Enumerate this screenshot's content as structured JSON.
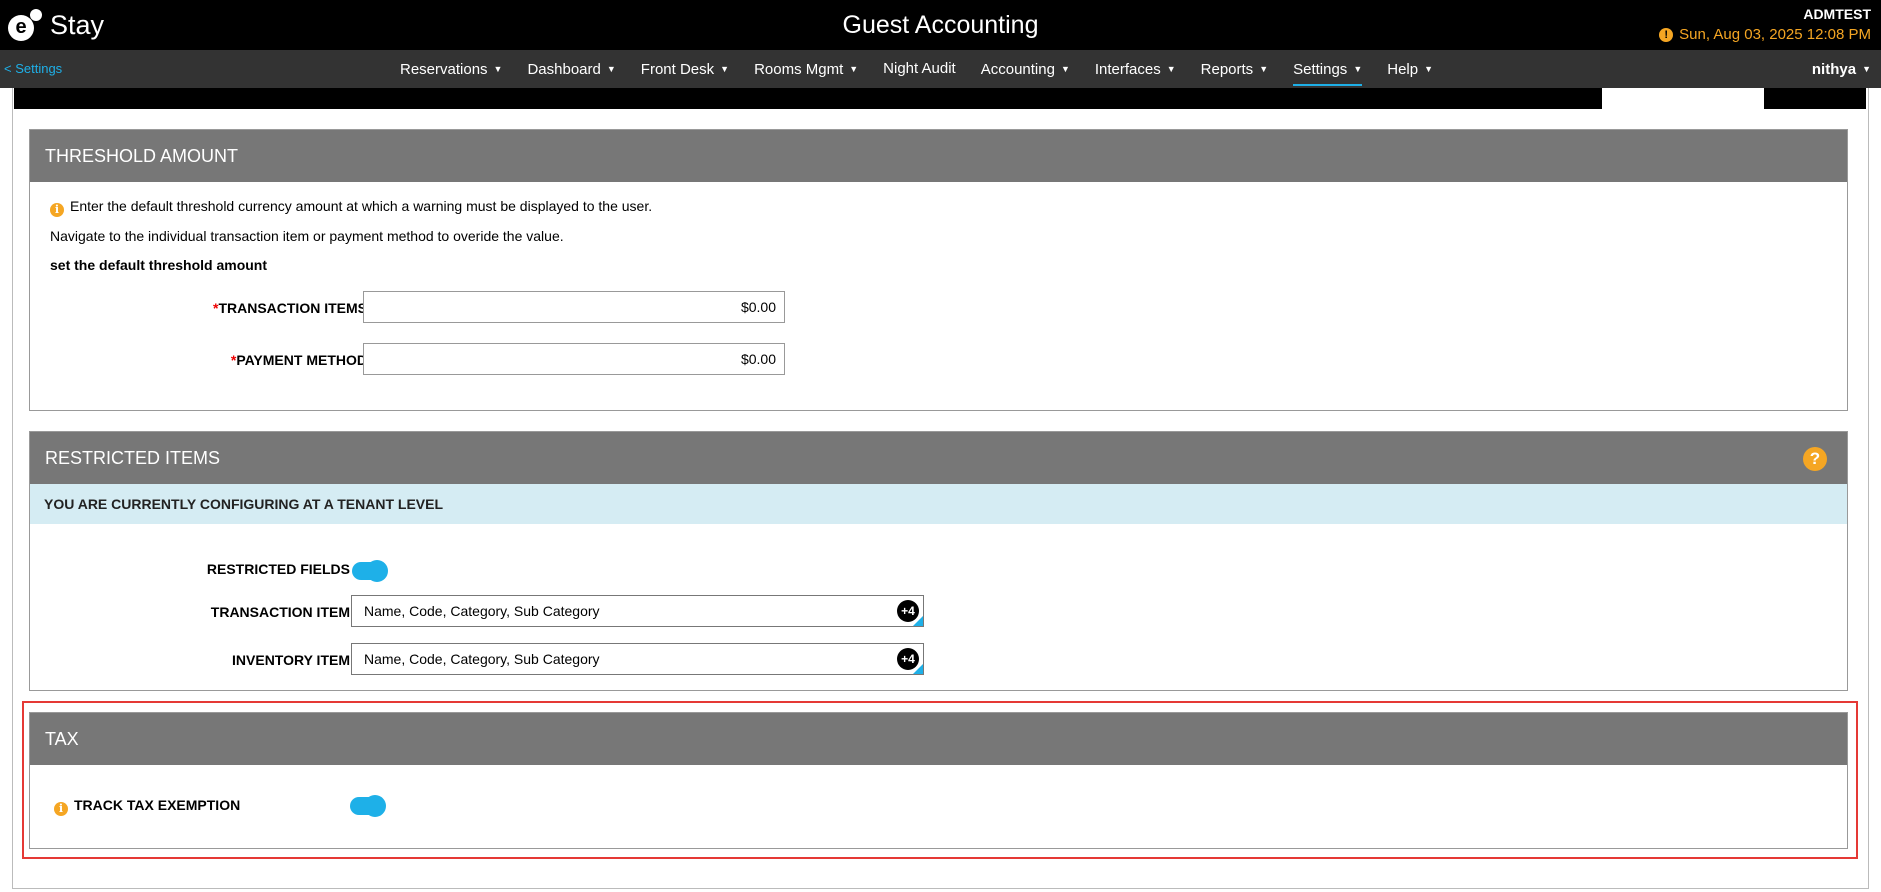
{
  "header": {
    "logo_letter": "e",
    "logo_text": "Stay",
    "title": "Guest Accounting",
    "tenant": "ADMTEST",
    "datetime": "Sun, Aug 03, 2025 12:08 PM",
    "datetime_color": "#f5a623"
  },
  "nav": {
    "back_label": "< Settings",
    "items": [
      {
        "label": "Reservations",
        "has_dropdown": true
      },
      {
        "label": "Dashboard",
        "has_dropdown": true
      },
      {
        "label": "Front Desk",
        "has_dropdown": true
      },
      {
        "label": "Rooms Mgmt",
        "has_dropdown": true
      },
      {
        "label": "Night Audit",
        "has_dropdown": false
      },
      {
        "label": "Accounting",
        "has_dropdown": true
      },
      {
        "label": "Interfaces",
        "has_dropdown": true
      },
      {
        "label": "Reports",
        "has_dropdown": true
      },
      {
        "label": "Settings",
        "has_dropdown": true,
        "active": true
      },
      {
        "label": "Help",
        "has_dropdown": true
      }
    ],
    "user": "nithya",
    "accent_color": "#1eb0e8"
  },
  "threshold": {
    "heading": "THRESHOLD AMOUNT",
    "info_line": "Enter the default threshold currency amount at which a warning must be displayed to the user.",
    "nav_line": "Navigate to the individual transaction item or payment method to overide the value.",
    "set_line": "set the default threshold amount",
    "transaction_items_label": "TRANSACTION ITEMS",
    "transaction_items_value": "$0.00",
    "payment_method_label": "PAYMENT METHOD",
    "payment_method_value": "$0.00",
    "required_marker": "*"
  },
  "restricted": {
    "heading": "RESTRICTED ITEMS",
    "help_symbol": "?",
    "banner": "YOU ARE CURRENTLY CONFIGURING AT A TENANT LEVEL",
    "restricted_fields_label": "RESTRICTED FIELDS",
    "restricted_fields_on": true,
    "transaction_item_label": "TRANSACTION ITEM",
    "transaction_item_value": "Name, Code, Category, Sub Category",
    "transaction_item_more": "+4",
    "inventory_item_label": "INVENTORY ITEM",
    "inventory_item_value": "Name, Code, Category, Sub Category",
    "inventory_item_more": "+4"
  },
  "tax": {
    "heading": "TAX",
    "track_label": "TRACK TAX EXEMPTION",
    "track_on": true,
    "highlight_color": "#e53935"
  }
}
